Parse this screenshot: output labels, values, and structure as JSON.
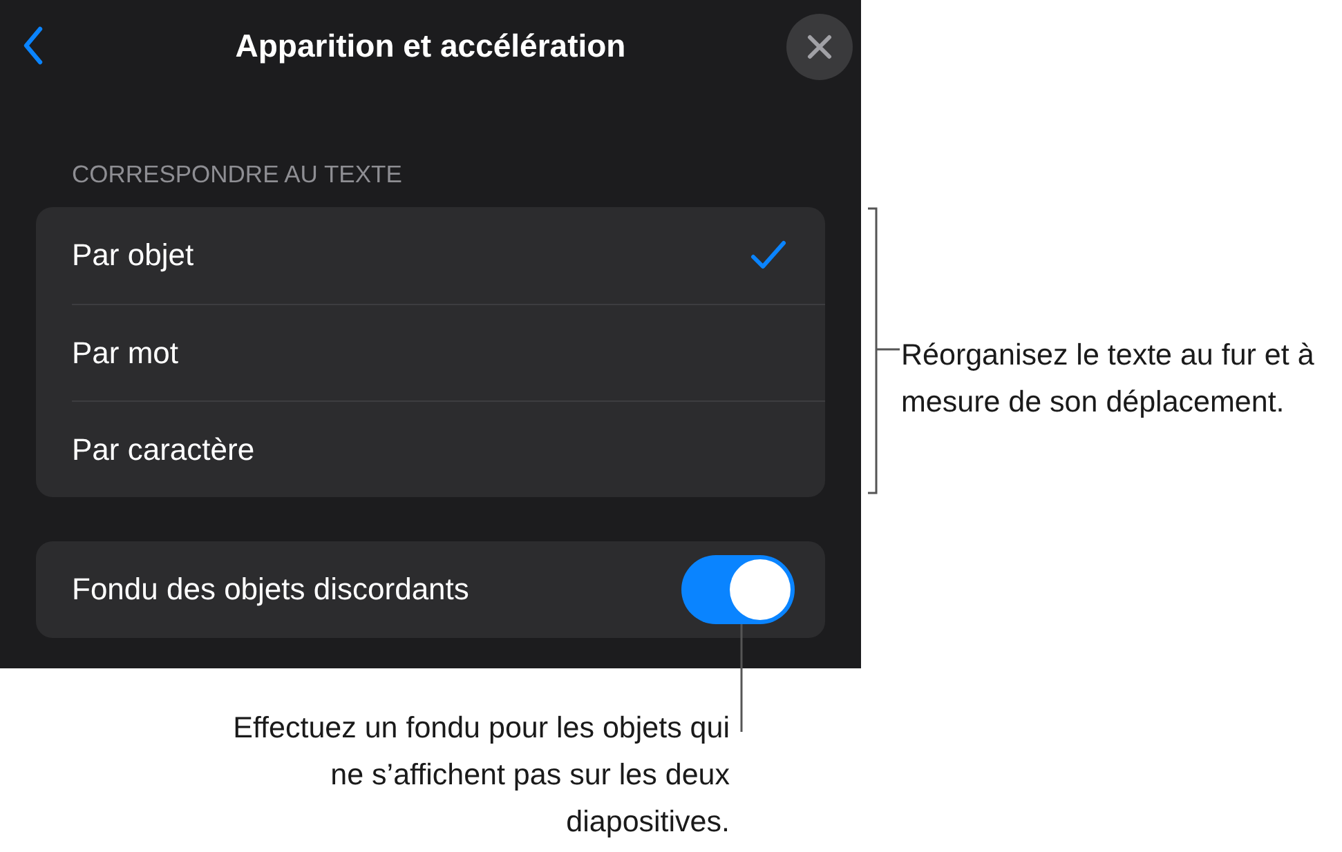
{
  "header": {
    "title": "Apparition et accélération"
  },
  "section": {
    "title": "CORRESPONDRE AU TEXTE",
    "options": [
      {
        "label": "Par objet",
        "selected": true
      },
      {
        "label": "Par mot",
        "selected": false
      },
      {
        "label": "Par caractère",
        "selected": false
      }
    ]
  },
  "fade_row": {
    "label": "Fondu des objets discordants",
    "on": true
  },
  "callouts": [
    {
      "kind": "bracket",
      "text": "Réorganisez le texte au fur et à mesure de son déplacement."
    },
    {
      "kind": "stem",
      "text": "Effectuez un fondu pour les objets qui ne s’affichent pas sur les deux diapositives."
    }
  ]
}
